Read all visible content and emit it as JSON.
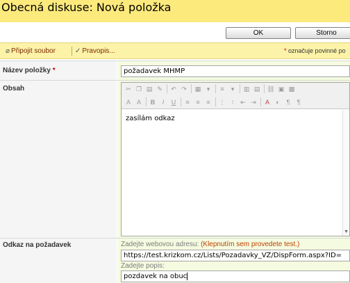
{
  "page": {
    "title": "Obecná diskuse: Nová položka"
  },
  "buttons": {
    "ok": "OK",
    "cancel": "Storno"
  },
  "toolbar": {
    "attach_label": "Připojit soubor",
    "attach_icon": "paperclip-icon",
    "spell_label": "Pravopis...",
    "spell_icon": "spellcheck-icon",
    "required_star": "*",
    "required_note": "označuje povinné po"
  },
  "fields": {
    "name": {
      "label": "Název položky",
      "required": "*",
      "value": "požadavek MHMP"
    },
    "body": {
      "label": "Obsah",
      "value": "zasílám odkaz"
    },
    "link": {
      "label": "Odkaz na požadavek",
      "url_hint": "Zadejte webovou adresu: ",
      "url_hint_click": "(Klepnutím sem provedete test.)",
      "url_value": "https://test.krizkom.cz/Lists/Pozadavky_VZ/DispForm.aspx?ID=",
      "desc_hint": "Zadejte popis:",
      "desc_value": "pozdavek na obuc"
    }
  },
  "colors": {
    "title_bar": "#fdea7d",
    "toolbar": "#fdf3a8",
    "field_background": "#f4fbe0",
    "label_background": "#f5f5f5",
    "required": "#c00000"
  }
}
